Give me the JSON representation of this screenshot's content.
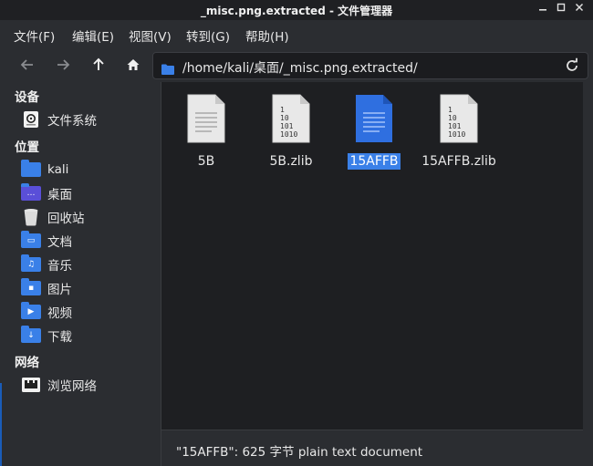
{
  "window": {
    "title": "_misc.png.extracted - 文件管理器"
  },
  "menu": [
    {
      "label": "文件(F)"
    },
    {
      "label": "编辑(E)"
    },
    {
      "label": "视图(V)"
    },
    {
      "label": "转到(G)"
    },
    {
      "label": "帮助(H)"
    }
  ],
  "toolbar": {
    "path": "/home/kali/桌面/_misc.png.extracted/"
  },
  "sidebar": {
    "devices_header": "设备",
    "devices": [
      {
        "label": "文件系统",
        "icon": "drive-icon"
      }
    ],
    "places_header": "位置",
    "places": [
      {
        "label": "kali",
        "icon": "home-folder-icon"
      },
      {
        "label": "桌面",
        "icon": "desktop-folder-icon"
      },
      {
        "label": "回收站",
        "icon": "trash-icon"
      },
      {
        "label": "文档",
        "icon": "documents-folder-icon"
      },
      {
        "label": "音乐",
        "icon": "music-folder-icon"
      },
      {
        "label": "图片",
        "icon": "pictures-folder-icon"
      },
      {
        "label": "视频",
        "icon": "videos-folder-icon"
      },
      {
        "label": "下载",
        "icon": "downloads-folder-icon"
      }
    ],
    "network_header": "网络",
    "network": [
      {
        "label": "浏览网络",
        "icon": "network-icon"
      }
    ]
  },
  "files": [
    {
      "name": "5B",
      "type": "text"
    },
    {
      "name": "5B.zlib",
      "type": "binary"
    },
    {
      "name": "15AFFB",
      "type": "text",
      "selected": true
    },
    {
      "name": "15AFFB.zlib",
      "type": "binary"
    }
  ],
  "status": {
    "text": "\"15AFFB\": 625 字节 plain text document"
  },
  "colors": {
    "accent": "#3a80e8",
    "window_bg": "#2b2d31",
    "view_bg": "#1e1f22"
  }
}
